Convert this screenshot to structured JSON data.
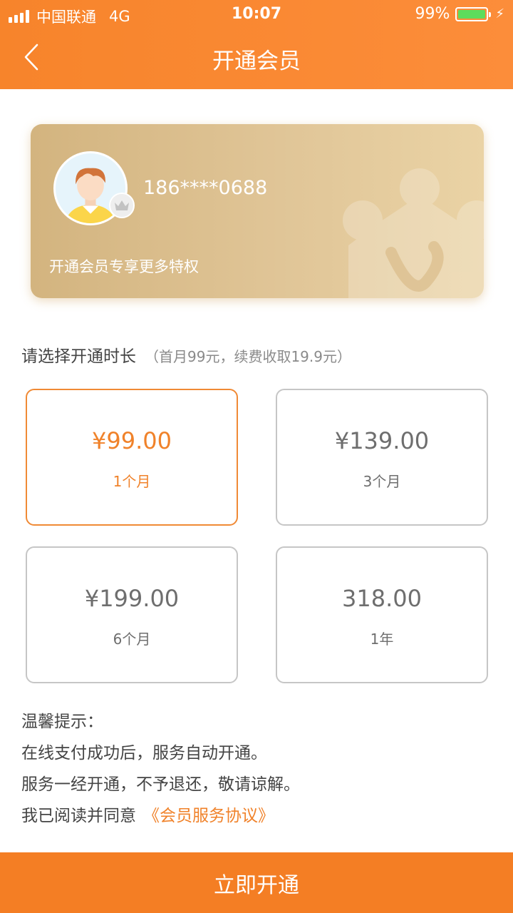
{
  "status_bar": {
    "carrier": "中国联通",
    "network": "4G",
    "time": "10:07",
    "battery": "99%",
    "battery_level": 0.99,
    "battery_color": "#5ddc5c"
  },
  "nav": {
    "back_icon": "chevron-left-icon",
    "title": "开通会员"
  },
  "member_card": {
    "phone": "186****0688",
    "subtitle": "开通会员专享更多特权",
    "badge_icon": "crown-icon"
  },
  "plans": {
    "label": "请选择开通时长",
    "hint": "（首月99元，续费收取19.9元）",
    "items": [
      {
        "price": "¥99.00",
        "duration": "1个月",
        "selected": true
      },
      {
        "price": "¥139.00",
        "duration": "3个月",
        "selected": false
      },
      {
        "price": "¥199.00",
        "duration": "6个月",
        "selected": false
      },
      {
        "price": "318.00",
        "duration": "1年",
        "selected": false
      }
    ]
  },
  "tips": {
    "heading": "温馨提示：",
    "line1": "在线支付成功后，服务自动开通。",
    "line2": "服务一经开通，不予退还，敬请谅解。",
    "agree_prefix": "我已阅读并同意",
    "agreement_link": "《会员服务协议》"
  },
  "cta": {
    "label": "立即开通"
  },
  "colors": {
    "accent": "#f47e24",
    "card_gold": "#dfc392",
    "selected_border": "#f08a35"
  }
}
